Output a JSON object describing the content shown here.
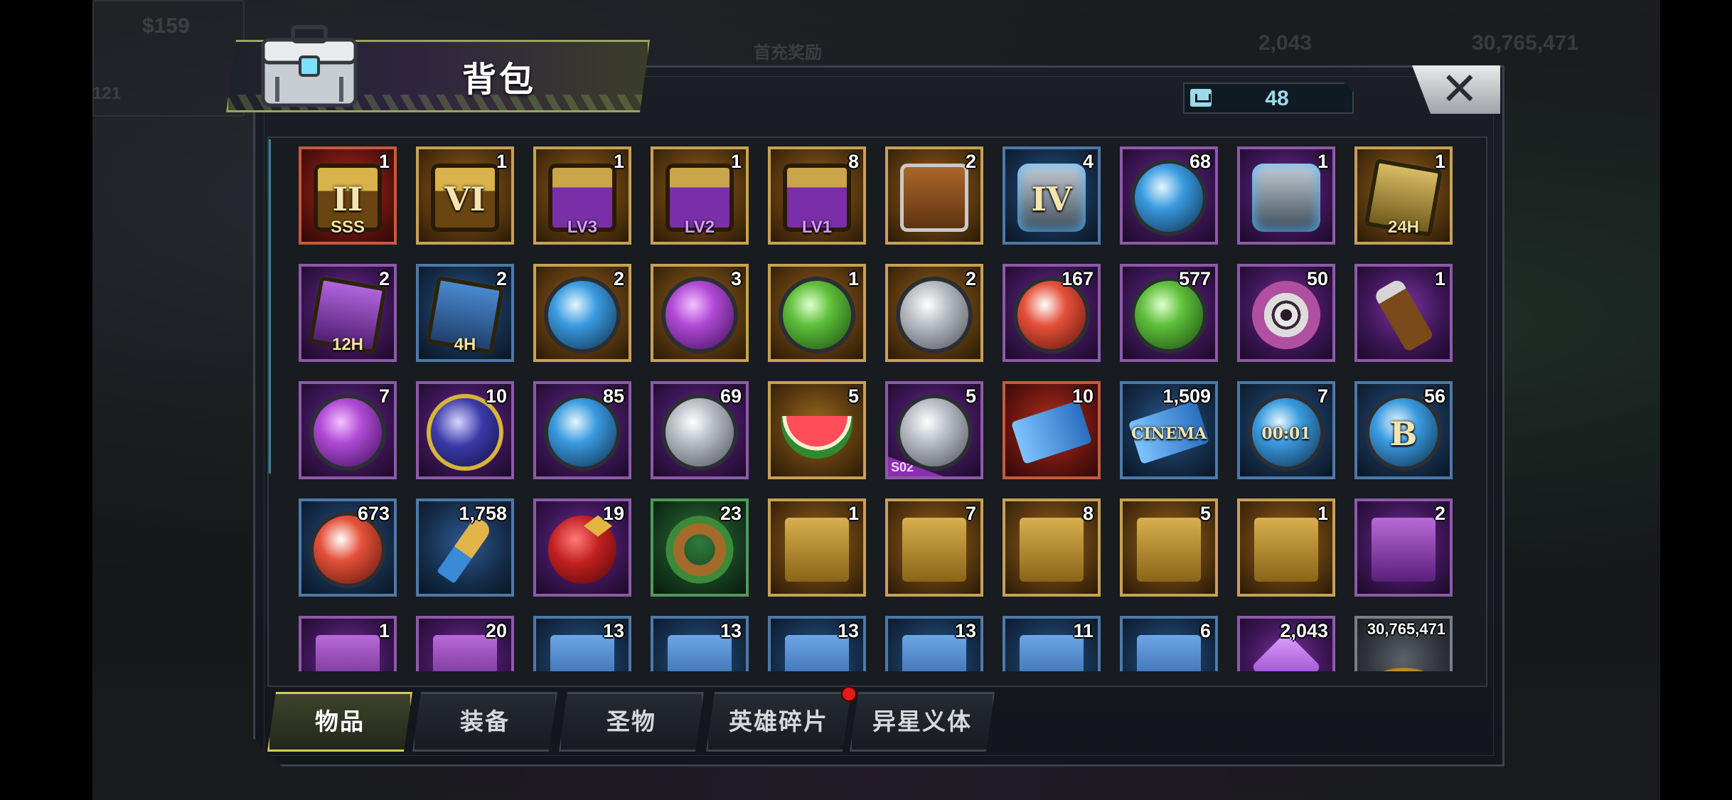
{
  "title": "背包",
  "capacity_counter": "48",
  "close_label": "✕",
  "tabs": [
    {
      "label": "物品",
      "active": true
    },
    {
      "label": "装备",
      "active": false
    },
    {
      "label": "圣物",
      "active": false
    },
    {
      "label": "英雄碎片",
      "active": false,
      "badge": true
    },
    {
      "label": "异星义体",
      "active": false
    }
  ],
  "items": [
    {
      "qty": "1",
      "icon": "sss-chest-icon",
      "rarity": "red",
      "shape": "sh-chest",
      "glyph": "II",
      "label": "SSS"
    },
    {
      "qty": "1",
      "icon": "green-chest-icon",
      "rarity": "gold",
      "shape": "sh-chest",
      "glyph": "VI"
    },
    {
      "qty": "1",
      "icon": "purple-chest-lv3-icon",
      "rarity": "gold",
      "shape": "sh-chest-purple",
      "label": "LV3"
    },
    {
      "qty": "1",
      "icon": "purple-chest-lv2-icon",
      "rarity": "gold",
      "shape": "sh-chest-purple",
      "label": "LV2"
    },
    {
      "qty": "8",
      "icon": "purple-chest-lv1-icon",
      "rarity": "gold",
      "shape": "sh-chest-purple",
      "label": "LV1"
    },
    {
      "qty": "2",
      "icon": "supply-crate-icon",
      "rarity": "gold",
      "shape": "sh-crate"
    },
    {
      "qty": "4",
      "icon": "tech-container-icon",
      "rarity": "blue",
      "shape": "sh-tech",
      "glyph": "IV"
    },
    {
      "qty": "68",
      "icon": "blue-capsule-icon",
      "rarity": "purple",
      "shape": "sh-token blue"
    },
    {
      "qty": "1",
      "icon": "purple-canister-icon",
      "rarity": "purple",
      "shape": "sh-tech"
    },
    {
      "qty": "1",
      "icon": "speedup-card-24h-icon",
      "rarity": "gold",
      "shape": "sh-card",
      "label": "24H"
    },
    {
      "qty": "2",
      "icon": "speedup-card-12h-icon",
      "rarity": "purple",
      "shape": "sh-card purple",
      "label": "12H"
    },
    {
      "qty": "2",
      "icon": "speedup-card-4h-icon",
      "rarity": "blue",
      "shape": "sh-card blue",
      "label": "4H"
    },
    {
      "qty": "2",
      "icon": "blue-badge-icon",
      "rarity": "gold",
      "shape": "sh-token blue"
    },
    {
      "qty": "3",
      "icon": "purple-badge-icon",
      "rarity": "gold",
      "shape": "sh-token purple"
    },
    {
      "qty": "1",
      "icon": "green-leaf-badge-icon",
      "rarity": "gold",
      "shape": "sh-token green"
    },
    {
      "qty": "2",
      "icon": "silver-badge-icon",
      "rarity": "gold",
      "shape": "sh-token"
    },
    {
      "qty": "167",
      "icon": "lips-token-icon",
      "rarity": "purple",
      "shape": "sh-token red"
    },
    {
      "qty": "577",
      "icon": "wheat-coin-icon",
      "rarity": "purple",
      "shape": "sh-token green"
    },
    {
      "qty": "50",
      "icon": "film-reel-icon",
      "rarity": "purple",
      "shape": "sh-reel"
    },
    {
      "qty": "1",
      "icon": "potion-bottle-icon",
      "rarity": "purple",
      "shape": "sh-bottle"
    },
    {
      "qty": "7",
      "icon": "purple-bottlecap-icon",
      "rarity": "purple",
      "shape": "sh-token purple"
    },
    {
      "qty": "10",
      "icon": "poker-chip-icon",
      "rarity": "purple",
      "shape": "sh-token navy"
    },
    {
      "qty": "85",
      "icon": "police-badge-icon",
      "rarity": "purple",
      "shape": "sh-token blue"
    },
    {
      "qty": "69",
      "icon": "trophy-bird-icon",
      "rarity": "purple",
      "shape": "sh-token"
    },
    {
      "qty": "5",
      "icon": "watermelon-icon",
      "rarity": "gold",
      "shape": "sh-melon"
    },
    {
      "qty": "5",
      "icon": "vault-dial-icon",
      "rarity": "purple",
      "shape": "sh-token",
      "tag": "S02"
    },
    {
      "qty": "10",
      "icon": "caution-ticket-icon",
      "rarity": "red",
      "shape": "sh-ticket"
    },
    {
      "qty": "1,509",
      "icon": "cinema-ticket-icon",
      "rarity": "blue",
      "shape": "sh-ticket",
      "glyph": "CINEMA"
    },
    {
      "qty": "7",
      "icon": "timer-token-icon",
      "rarity": "blue",
      "shape": "sh-token blue",
      "glyph": "00:01"
    },
    {
      "qty": "56",
      "icon": "blue-b-cap-icon",
      "rarity": "blue",
      "shape": "sh-token blue",
      "glyph": "B"
    },
    {
      "qty": "673",
      "icon": "red-poker-chip-icon",
      "rarity": "blue",
      "shape": "sh-token red"
    },
    {
      "qty": "1,758",
      "icon": "bullet-icon",
      "rarity": "blue",
      "shape": "sh-bullet"
    },
    {
      "qty": "19",
      "icon": "christmas-ornament-icon",
      "rarity": "purple",
      "shape": "sh-ball"
    },
    {
      "qty": "23",
      "icon": "wreath-icon",
      "rarity": "green",
      "shape": "sh-wreath"
    },
    {
      "qty": "1",
      "icon": "glasses-blueprint-icon",
      "rarity": "gold",
      "shape": "sh-glasses"
    },
    {
      "qty": "7",
      "icon": "weapon-blueprint-icon",
      "rarity": "gold",
      "shape": "sh-glasses"
    },
    {
      "qty": "8",
      "icon": "hat-blueprint-icon",
      "rarity": "gold",
      "shape": "sh-glasses"
    },
    {
      "qty": "5",
      "icon": "shirt-blueprint-icon",
      "rarity": "gold",
      "shape": "sh-glasses"
    },
    {
      "qty": "1",
      "icon": "boots-blueprint-icon",
      "rarity": "gold",
      "shape": "sh-glasses"
    },
    {
      "qty": "2",
      "icon": "purple-hat-blueprint-icon",
      "rarity": "purple",
      "shape": "sh-glasses purple"
    },
    {
      "qty": "1",
      "icon": "purple-blueprint-icon",
      "rarity": "purple",
      "shape": "sh-glasses purple"
    },
    {
      "qty": "20",
      "icon": "purple-shirt-blueprint-icon",
      "rarity": "purple",
      "shape": "sh-glasses purple"
    },
    {
      "qty": "13",
      "icon": "blue-blueprint-icon",
      "rarity": "blue",
      "shape": "sh-glasses blue"
    },
    {
      "qty": "13",
      "icon": "blue-blueprint-icon",
      "rarity": "blue",
      "shape": "sh-glasses blue"
    },
    {
      "qty": "13",
      "icon": "blue-blueprint-icon",
      "rarity": "blue",
      "shape": "sh-glasses blue"
    },
    {
      "qty": "13",
      "icon": "blue-blueprint-icon",
      "rarity": "blue",
      "shape": "sh-glasses blue"
    },
    {
      "qty": "11",
      "icon": "blue-blueprint-icon",
      "rarity": "blue",
      "shape": "sh-glasses blue"
    },
    {
      "qty": "6",
      "icon": "blue-blueprint-icon",
      "rarity": "blue",
      "shape": "sh-glasses blue"
    },
    {
      "qty": "2,043",
      "icon": "purple-crystal-icon",
      "rarity": "purple",
      "shape": "sh-gem"
    },
    {
      "qty": "30,765,471",
      "icon": "gold-coins-icon",
      "rarity": "grey",
      "shape": "sh-coins",
      "small": true
    }
  ],
  "background_hud": {
    "left_money": "$159",
    "gems": "2,043",
    "coins": "30,765,471",
    "level": "121",
    "first_recharge": "首充奖励"
  }
}
